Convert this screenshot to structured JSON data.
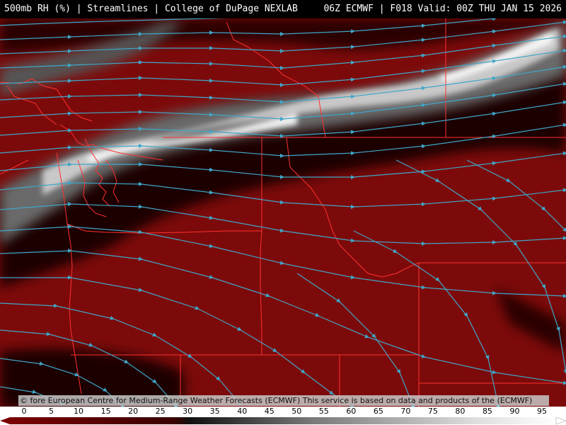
{
  "header": {
    "left_title": "500mb RH (%) | Streamlines | College of DuPage NEXLAB",
    "right_title": "06Z ECMWF | F018 Valid: 00Z THU JAN 15 2026"
  },
  "credit_text": "© fore European Centre for Medium-Range Weather Forecasts (ECMWF) This service is based on data and products of the (ECMWF)",
  "legend": {
    "ticks": [
      "0",
      "5",
      "10",
      "15",
      "20",
      "25",
      "30",
      "35",
      "40",
      "45",
      "50",
      "55",
      "60",
      "65",
      "70",
      "75",
      "80",
      "85",
      "90",
      "95"
    ],
    "colors": {
      "dry": "#7a0000",
      "mid": "#3a3a3a",
      "moist": "#ffffff",
      "streamline": "#3fa6c8",
      "border": "#ff3030"
    }
  }
}
